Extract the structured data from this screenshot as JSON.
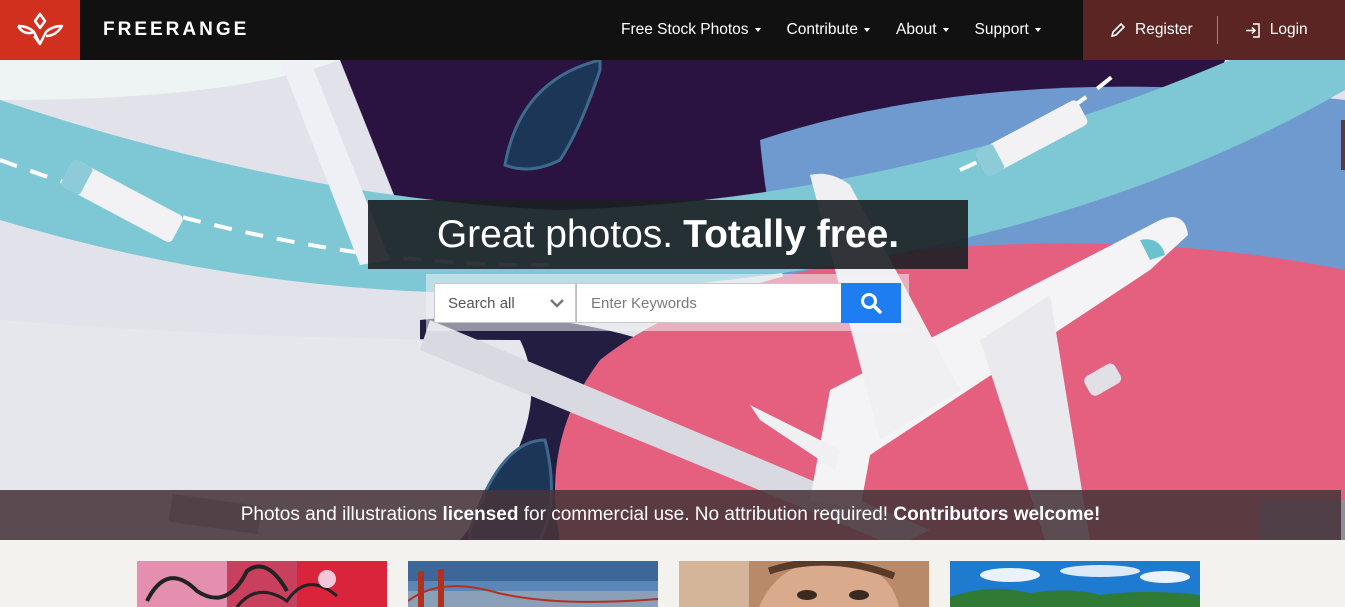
{
  "nav": {
    "brand": "FREERANGE",
    "menu": [
      {
        "label": "Free Stock Photos"
      },
      {
        "label": "Contribute"
      },
      {
        "label": "About"
      },
      {
        "label": "Support"
      }
    ],
    "register_label": "Register",
    "login_label": "Login"
  },
  "hero": {
    "headline_regular": "Great photos.",
    "headline_bold": "Totally free.",
    "search": {
      "category_selected": "Search all",
      "placeholder": "Enter Keywords"
    }
  },
  "license": {
    "part1": "Photos and illustrations ",
    "part2_bold": "licensed",
    "part3": " for commercial use. No attribution required! ",
    "part4_bold": "Contributors welcome!"
  },
  "colors": {
    "nav_bg": "#111111",
    "logo_bg": "#d2301f",
    "auth_bg": "#5a2523",
    "search_button": "#1e7df0"
  },
  "icons": {
    "logo": "bird-icon",
    "register": "pencil-icon",
    "login": "login-icon",
    "search": "search-icon",
    "dropdown": "chevron-down-icon"
  }
}
